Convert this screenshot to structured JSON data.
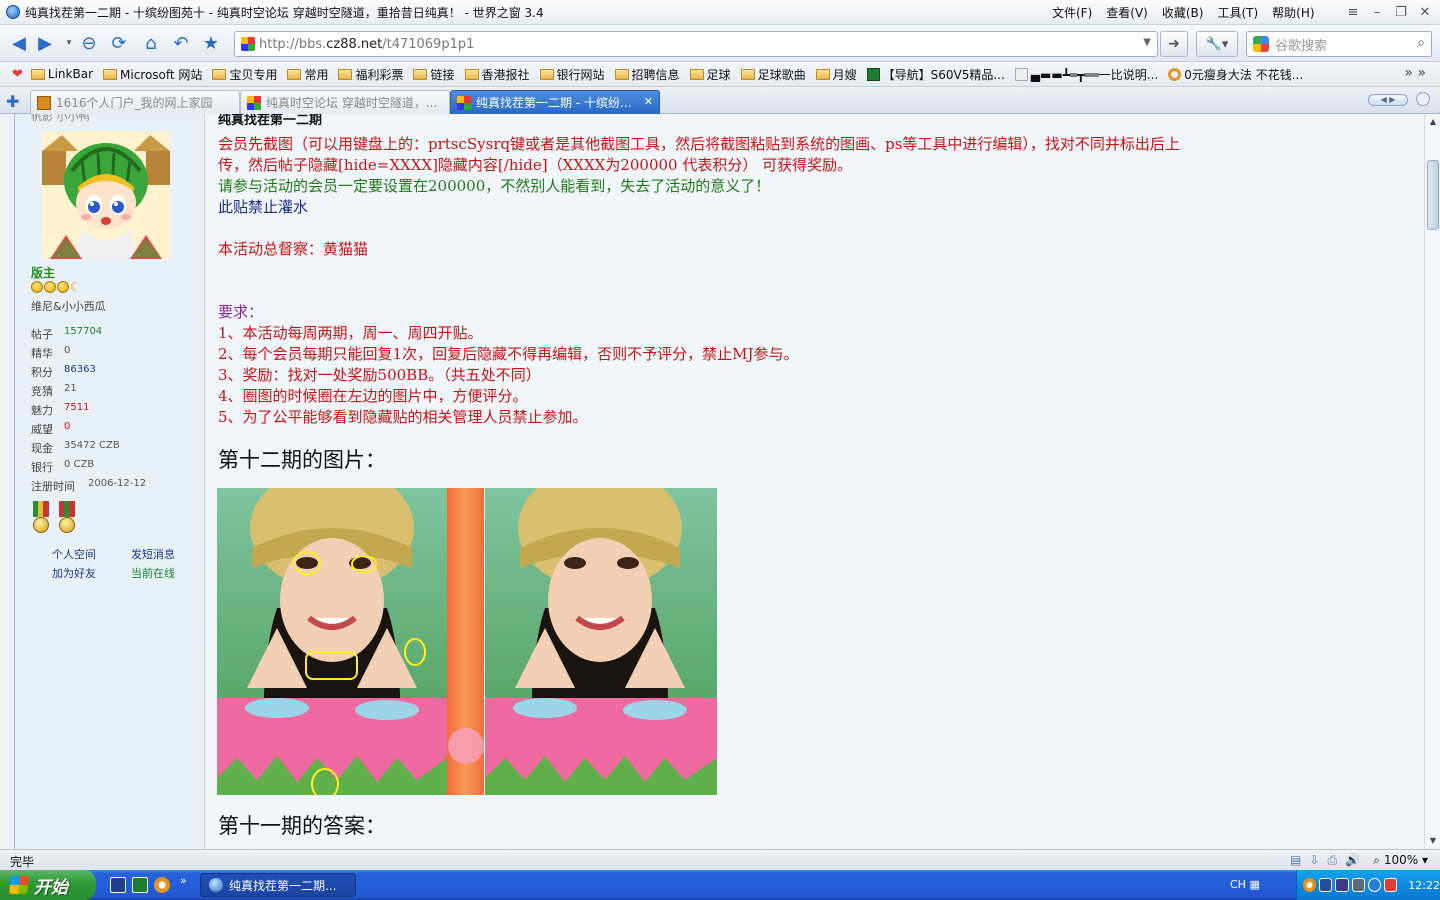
{
  "window": {
    "title": "纯真找茬第一二期 - 十缤纷图苑十 - 纯真时空论坛 穿越时空隧道，重拾昔日纯真！ - 世界之窗 3.4",
    "menus": [
      "文件(F)",
      "查看(V)",
      "收藏(B)",
      "工具(T)",
      "帮助(H)"
    ]
  },
  "nav": {
    "url_prefix": "http://bbs.",
    "url_domain": "cz88.net",
    "url_path": "/t471069p1p1",
    "search_placeholder": "谷歌搜索"
  },
  "bookmarks": [
    {
      "label": "LinkBar",
      "icon": "folder-icon"
    },
    {
      "label": "Microsoft 网站",
      "icon": "folder-icon"
    },
    {
      "label": "宝贝专用",
      "icon": "folder-icon"
    },
    {
      "label": "常用",
      "icon": "folder-icon"
    },
    {
      "label": "福利彩票",
      "icon": "folder-icon"
    },
    {
      "label": "链接",
      "icon": "folder-icon"
    },
    {
      "label": "香港报社",
      "icon": "folder-icon"
    },
    {
      "label": "银行网站",
      "icon": "folder-icon"
    },
    {
      "label": "招聘信息",
      "icon": "folder-icon"
    },
    {
      "label": "足球",
      "icon": "folder-icon"
    },
    {
      "label": "足球歌曲",
      "icon": "folder-icon"
    },
    {
      "label": "月嫂",
      "icon": "folder-icon"
    },
    {
      "label": "【导航】S60V5精品...",
      "icon": "page-icon"
    },
    {
      "label": "▄▬▬┻═┳══一比说明...",
      "icon": "page-icon"
    },
    {
      "label": "0元瘦身大法 不花钱...",
      "icon": "page-icon"
    }
  ],
  "tabs": [
    {
      "label": "1616个人门户_我的网上家园",
      "active": false
    },
    {
      "label": "纯真时空论坛 穿越时空隧道，...",
      "active": false
    },
    {
      "label": "纯真找茬第一二期 - 十缤纷...",
      "active": true
    }
  ],
  "profile": {
    "username_partial": "帆影 小小鸭",
    "rank": "版主",
    "nickname": "维尼&小小西瓜",
    "stats": [
      {
        "key": "帖子",
        "value": "157704"
      },
      {
        "key": "精华",
        "value": "0"
      },
      {
        "key": "积分",
        "value": "86363"
      },
      {
        "key": "竞猜",
        "value": "21"
      },
      {
        "key": "魅力",
        "value": "7511"
      },
      {
        "key": "威望",
        "value": "0"
      },
      {
        "key": "现金",
        "value": "35472 CZB"
      },
      {
        "key": "银行",
        "value": "0 CZB"
      },
      {
        "key": "注册时间",
        "value": "2006-12-12"
      }
    ],
    "links": {
      "space": "个人空间",
      "message": "发短消息",
      "add_friend": "加为好友",
      "online": "当前在线"
    }
  },
  "post": {
    "title": "纯真找茬第一二期",
    "lines": [
      "会员先截图（可以用键盘上的：prtscSysrq键或者是其他截图工具，然后将截图粘贴到系统的图画、ps等工具中进行编辑），找对不同并标出后上",
      "传，然后帖子隐藏[hide=XXXX]隐藏内容[/hide]（XXXX为200000 代表积分） 可获得奖励。",
      "请参与活动的会员一定要设置在200000，不然别人能看到，失去了活动的意义了！",
      "此贴禁止灌水",
      "本活动总督察：黄猫猫",
      "要求：",
      "1、本活动每周两期，周一、周四开贴。",
      "2、每个会员每期只能回复1次，回复后隐藏不得再编辑，否则不予评分，禁止MJ参与。",
      "3、奖励：找对一处奖励500BB。（共五处不同）",
      "4、圈图的时候圈在左边的图片中，方便评分。",
      "5、为了公平能够看到隐藏贴的相关管理人员禁止参加。"
    ],
    "heading1": "第十二期的图片：",
    "heading2": "第十一期的答案："
  },
  "status": {
    "text": "完毕",
    "zoom": "100%"
  },
  "taskbar": {
    "start": "开始",
    "task": "纯真找茬第一二期...",
    "lang": "CH",
    "clock": "12:22"
  },
  "colors": {
    "active_tab": "#2a69c4",
    "post_red": "#c81414",
    "post_green": "#1f7a17",
    "post_navy": "#1a2a8a",
    "post_purple": "#8a2a9a",
    "taskbar": "#245edb"
  }
}
